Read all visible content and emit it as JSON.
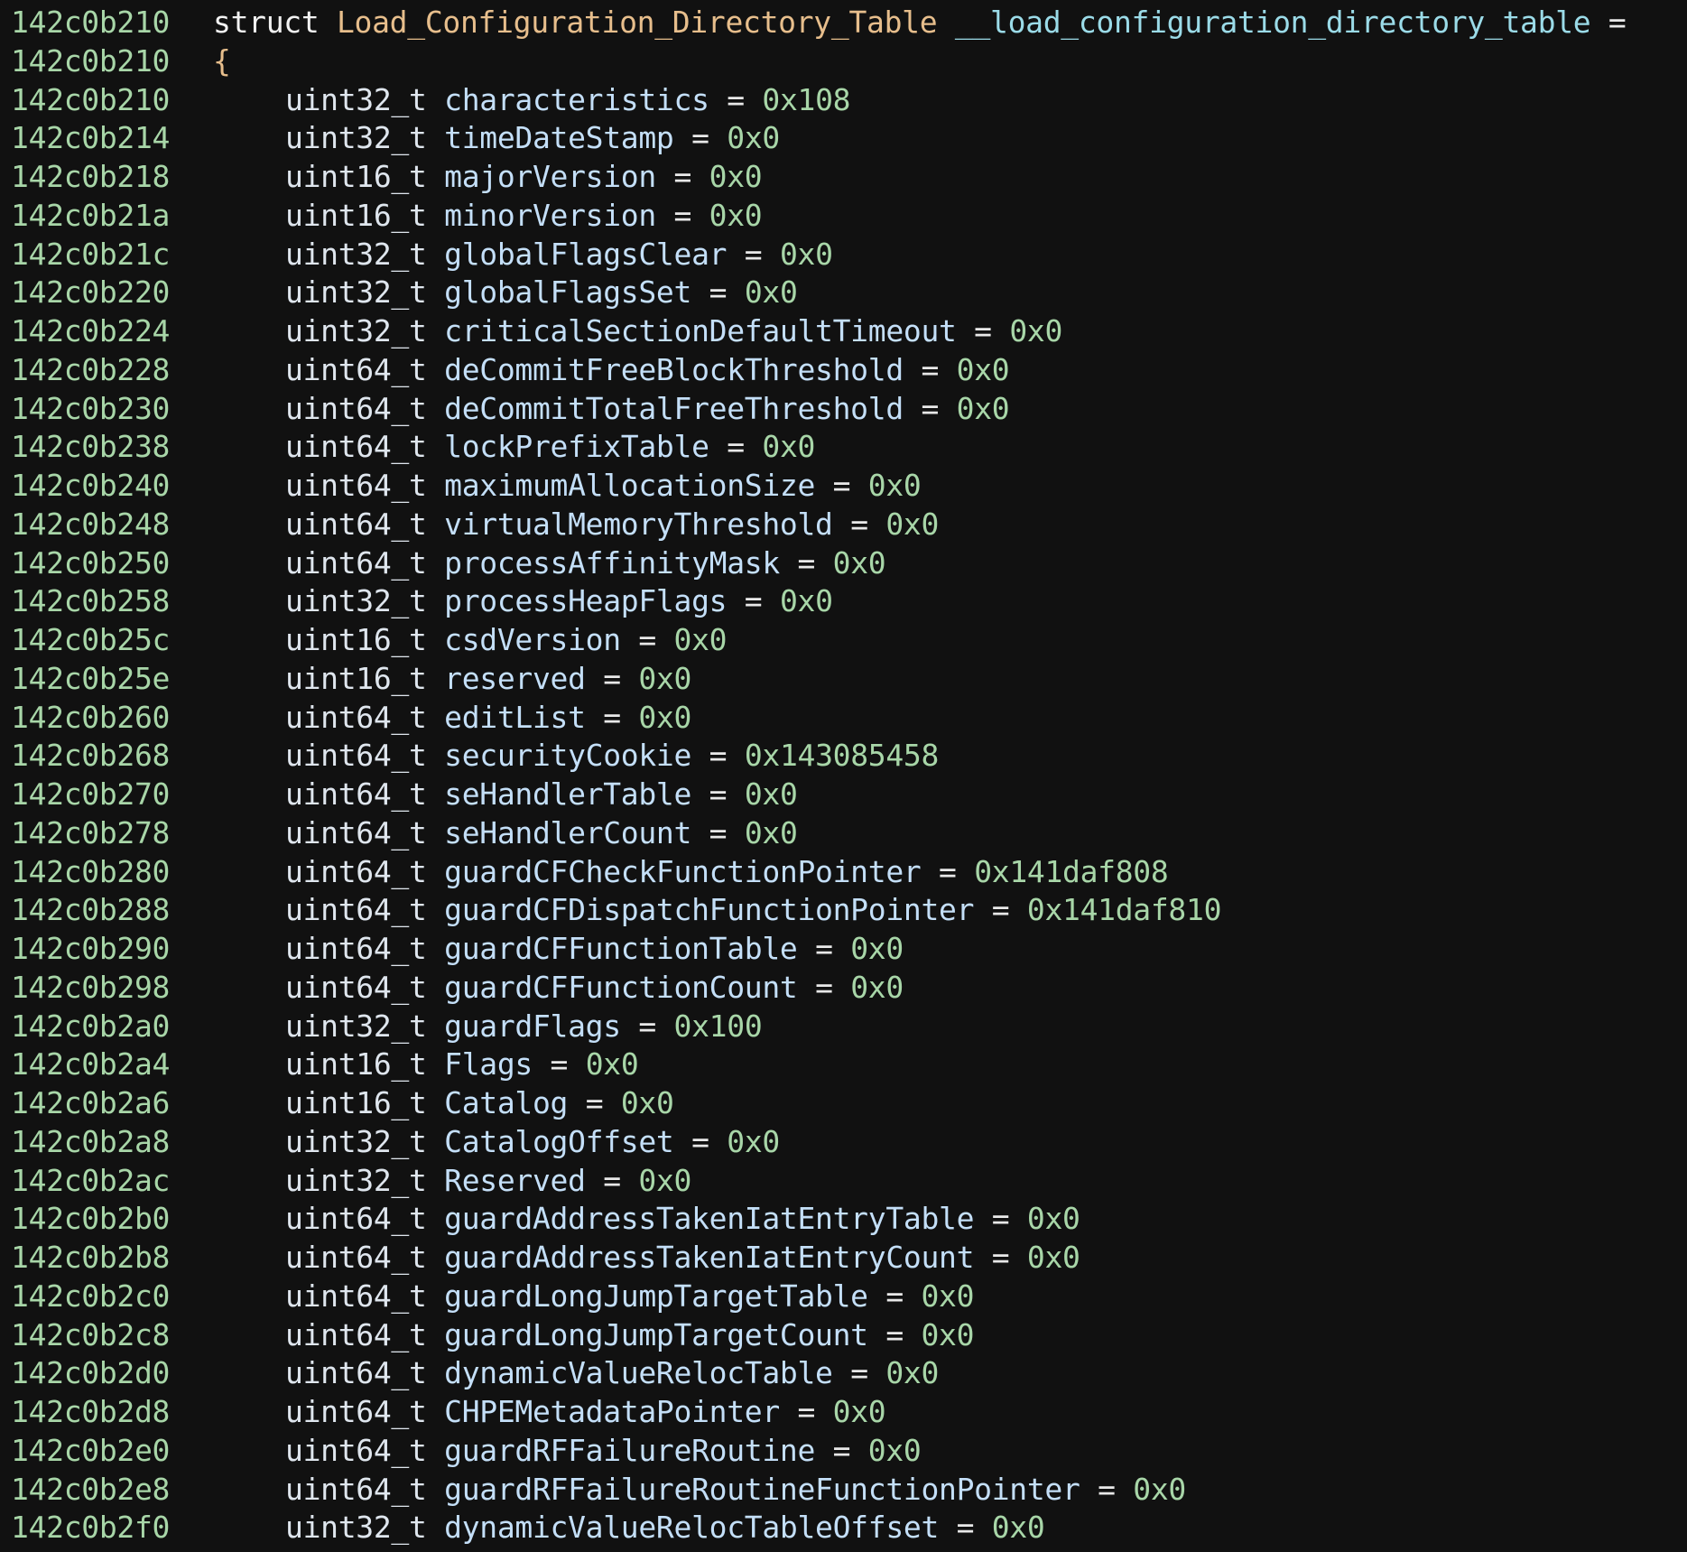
{
  "header": {
    "address": "142c0b210",
    "keyword": "struct",
    "type_name": "Load_Configuration_Directory_Table",
    "var_name": "__load_configuration_directory_table",
    "assign": "="
  },
  "open_brace": {
    "address": "142c0b210",
    "text": "{"
  },
  "members": [
    {
      "address": "142c0b210",
      "type": "uint32_t",
      "name": "characteristics",
      "value": "0x108"
    },
    {
      "address": "142c0b214",
      "type": "uint32_t",
      "name": "timeDateStamp",
      "value": "0x0"
    },
    {
      "address": "142c0b218",
      "type": "uint16_t",
      "name": "majorVersion",
      "value": "0x0"
    },
    {
      "address": "142c0b21a",
      "type": "uint16_t",
      "name": "minorVersion",
      "value": "0x0"
    },
    {
      "address": "142c0b21c",
      "type": "uint32_t",
      "name": "globalFlagsClear",
      "value": "0x0"
    },
    {
      "address": "142c0b220",
      "type": "uint32_t",
      "name": "globalFlagsSet",
      "value": "0x0"
    },
    {
      "address": "142c0b224",
      "type": "uint32_t",
      "name": "criticalSectionDefaultTimeout",
      "value": "0x0"
    },
    {
      "address": "142c0b228",
      "type": "uint64_t",
      "name": "deCommitFreeBlockThreshold",
      "value": "0x0"
    },
    {
      "address": "142c0b230",
      "type": "uint64_t",
      "name": "deCommitTotalFreeThreshold",
      "value": "0x0"
    },
    {
      "address": "142c0b238",
      "type": "uint64_t",
      "name": "lockPrefixTable",
      "value": "0x0"
    },
    {
      "address": "142c0b240",
      "type": "uint64_t",
      "name": "maximumAllocationSize",
      "value": "0x0"
    },
    {
      "address": "142c0b248",
      "type": "uint64_t",
      "name": "virtualMemoryThreshold",
      "value": "0x0"
    },
    {
      "address": "142c0b250",
      "type": "uint64_t",
      "name": "processAffinityMask",
      "value": "0x0"
    },
    {
      "address": "142c0b258",
      "type": "uint32_t",
      "name": "processHeapFlags",
      "value": "0x0"
    },
    {
      "address": "142c0b25c",
      "type": "uint16_t",
      "name": "csdVersion",
      "value": "0x0"
    },
    {
      "address": "142c0b25e",
      "type": "uint16_t",
      "name": "reserved",
      "value": "0x0"
    },
    {
      "address": "142c0b260",
      "type": "uint64_t",
      "name": "editList",
      "value": "0x0"
    },
    {
      "address": "142c0b268",
      "type": "uint64_t",
      "name": "securityCookie",
      "value": "0x143085458"
    },
    {
      "address": "142c0b270",
      "type": "uint64_t",
      "name": "seHandlerTable",
      "value": "0x0"
    },
    {
      "address": "142c0b278",
      "type": "uint64_t",
      "name": "seHandlerCount",
      "value": "0x0"
    },
    {
      "address": "142c0b280",
      "type": "uint64_t",
      "name": "guardCFCheckFunctionPointer",
      "value": "0x141daf808"
    },
    {
      "address": "142c0b288",
      "type": "uint64_t",
      "name": "guardCFDispatchFunctionPointer",
      "value": "0x141daf810"
    },
    {
      "address": "142c0b290",
      "type": "uint64_t",
      "name": "guardCFFunctionTable",
      "value": "0x0"
    },
    {
      "address": "142c0b298",
      "type": "uint64_t",
      "name": "guardCFFunctionCount",
      "value": "0x0"
    },
    {
      "address": "142c0b2a0",
      "type": "uint32_t",
      "name": "guardFlags",
      "value": "0x100"
    },
    {
      "address": "142c0b2a4",
      "type": "uint16_t",
      "name": "Flags",
      "value": "0x0"
    },
    {
      "address": "142c0b2a6",
      "type": "uint16_t",
      "name": "Catalog",
      "value": "0x0"
    },
    {
      "address": "142c0b2a8",
      "type": "uint32_t",
      "name": "CatalogOffset",
      "value": "0x0"
    },
    {
      "address": "142c0b2ac",
      "type": "uint32_t",
      "name": "Reserved",
      "value": "0x0"
    },
    {
      "address": "142c0b2b0",
      "type": "uint64_t",
      "name": "guardAddressTakenIatEntryTable",
      "value": "0x0"
    },
    {
      "address": "142c0b2b8",
      "type": "uint64_t",
      "name": "guardAddressTakenIatEntryCount",
      "value": "0x0"
    },
    {
      "address": "142c0b2c0",
      "type": "uint64_t",
      "name": "guardLongJumpTargetTable",
      "value": "0x0"
    },
    {
      "address": "142c0b2c8",
      "type": "uint64_t",
      "name": "guardLongJumpTargetCount",
      "value": "0x0"
    },
    {
      "address": "142c0b2d0",
      "type": "uint64_t",
      "name": "dynamicValueRelocTable",
      "value": "0x0"
    },
    {
      "address": "142c0b2d8",
      "type": "uint64_t",
      "name": "CHPEMetadataPointer",
      "value": "0x0"
    },
    {
      "address": "142c0b2e0",
      "type": "uint64_t",
      "name": "guardRFFailureRoutine",
      "value": "0x0"
    },
    {
      "address": "142c0b2e8",
      "type": "uint64_t",
      "name": "guardRFFailureRoutineFunctionPointer",
      "value": "0x0"
    },
    {
      "address": "142c0b2f0",
      "type": "uint32_t",
      "name": "dynamicValueRelocTableOffset",
      "value": "0x0"
    }
  ],
  "assign_op": "=",
  "colors": {
    "background": "#111111",
    "address": "#a8d6a8",
    "keyword": "#f2f2f2",
    "type_name": "#e7be8c",
    "var_name": "#9bdbe8",
    "field": "#c4dff8",
    "number": "#a8d6a8"
  }
}
